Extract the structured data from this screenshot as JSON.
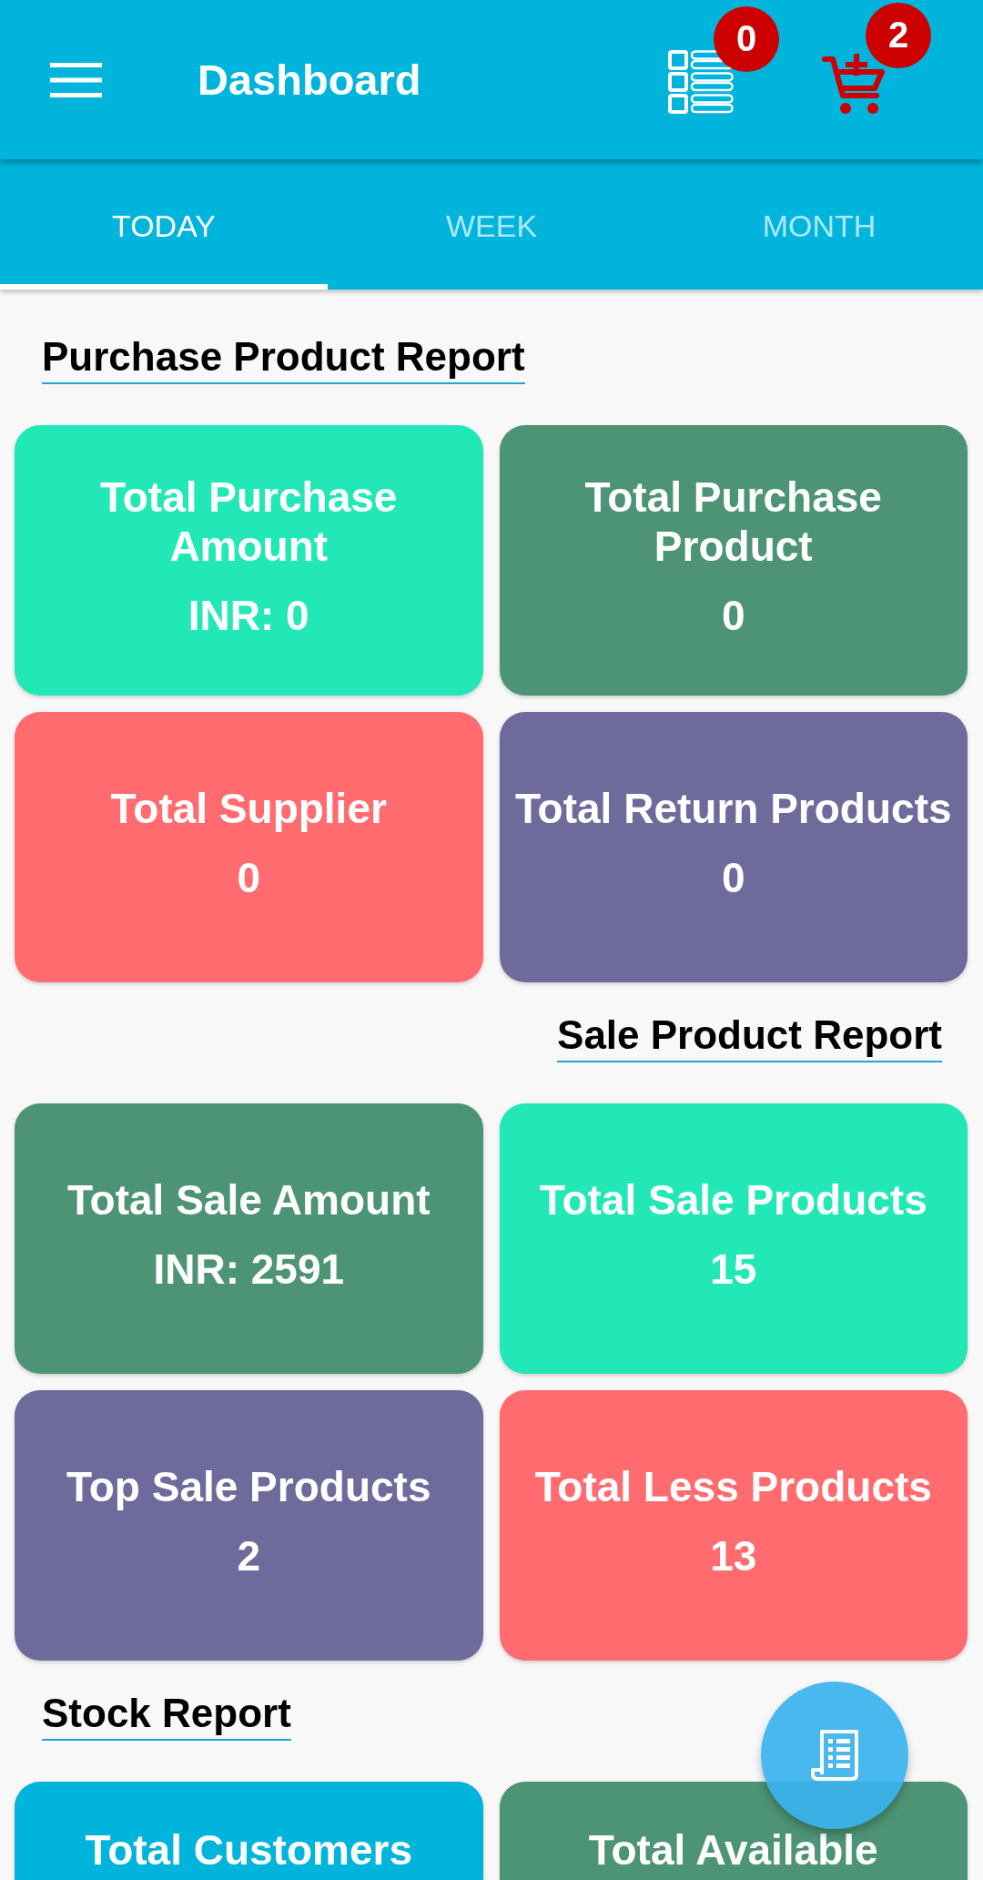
{
  "app_bar": {
    "title": "Dashboard",
    "list_badge": "0",
    "cart_badge": "2"
  },
  "tabs": [
    {
      "label": "TODAY",
      "selected": true
    },
    {
      "label": "WEEK",
      "selected": false
    },
    {
      "label": "MONTH",
      "selected": false
    }
  ],
  "sections": [
    {
      "title": "Purchase Product Report",
      "cards": [
        {
          "label": "Total Purchase Amount",
          "value": "INR: 0",
          "color": "#21e8b6"
        },
        {
          "label": "Total Purchase Product",
          "value": "0",
          "color": "#4d9476"
        },
        {
          "label": "Total Supplier",
          "value": "0",
          "color": "#ff6b6e"
        },
        {
          "label": "Total Return Products",
          "value": "0",
          "color": "#6e6a9b"
        }
      ]
    },
    {
      "title": "Sale Product Report",
      "cards": [
        {
          "label": "Total Sale Amount",
          "value": "INR: 2591",
          "color": "#4d9476"
        },
        {
          "label": "Total Sale Products",
          "value": "15",
          "color": "#21e8b6"
        },
        {
          "label": "Top Sale Products",
          "value": "2",
          "color": "#6e6a9b"
        },
        {
          "label": "Total Less Products",
          "value": "13",
          "color": "#ff6b6e"
        }
      ]
    },
    {
      "title": "Stock Report",
      "cards": [
        {
          "label": "Total Customers",
          "color": "#00b4dc"
        },
        {
          "label": "Total Available",
          "color": "#4d9476"
        }
      ]
    }
  ]
}
